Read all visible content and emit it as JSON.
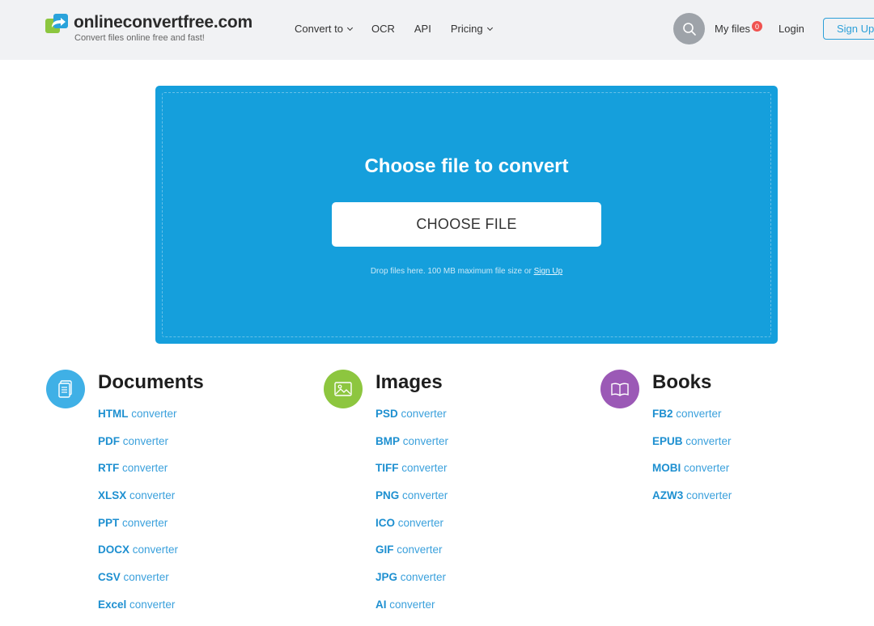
{
  "header": {
    "logo_name": "onlineconvertfree.com",
    "logo_tagline": "Convert files online free and fast!",
    "nav": [
      {
        "label": "Convert to",
        "has_dropdown": true
      },
      {
        "label": "OCR",
        "has_dropdown": false
      },
      {
        "label": "API",
        "has_dropdown": false
      },
      {
        "label": "Pricing",
        "has_dropdown": true
      }
    ],
    "search_icon": "search-icon",
    "my_files_label": "My files",
    "my_files_count": "0",
    "login_label": "Login",
    "signup_label": "Sign Up"
  },
  "upload": {
    "title": "Choose file to convert",
    "button_label": "CHOOSE FILE",
    "note": "Drop files here. 100 MB maximum file size or",
    "note_link": "Sign Up"
  },
  "colors": {
    "primary_blue": "#159fdc",
    "documents_icon_bg": "#3fb0e6",
    "images_icon_bg": "#8dc63f",
    "books_icon_bg": "#9b59b6",
    "badge_red": "#f0524f"
  },
  "categories": [
    {
      "title": "Documents",
      "icon": "document-icon",
      "items": [
        {
          "format": "HTML",
          "suffix": "converter"
        },
        {
          "format": "PDF",
          "suffix": "converter"
        },
        {
          "format": "RTF",
          "suffix": "converter"
        },
        {
          "format": "XLSX",
          "suffix": "converter"
        },
        {
          "format": "PPT",
          "suffix": "converter"
        },
        {
          "format": "DOCX",
          "suffix": "converter"
        },
        {
          "format": "CSV",
          "suffix": "converter"
        },
        {
          "format": "Excel",
          "suffix": "converter"
        }
      ]
    },
    {
      "title": "Images",
      "icon": "image-icon",
      "items": [
        {
          "format": "PSD",
          "suffix": "converter"
        },
        {
          "format": "BMP",
          "suffix": "converter"
        },
        {
          "format": "TIFF",
          "suffix": "converter"
        },
        {
          "format": "PNG",
          "suffix": "converter"
        },
        {
          "format": "ICO",
          "suffix": "converter"
        },
        {
          "format": "GIF",
          "suffix": "converter"
        },
        {
          "format": "JPG",
          "suffix": "converter"
        },
        {
          "format": "AI",
          "suffix": "converter"
        }
      ]
    },
    {
      "title": "Books",
      "icon": "book-icon",
      "items": [
        {
          "format": "FB2",
          "suffix": "converter"
        },
        {
          "format": "EPUB",
          "suffix": "converter"
        },
        {
          "format": "MOBI",
          "suffix": "converter"
        },
        {
          "format": "AZW3",
          "suffix": "converter"
        }
      ]
    }
  ]
}
